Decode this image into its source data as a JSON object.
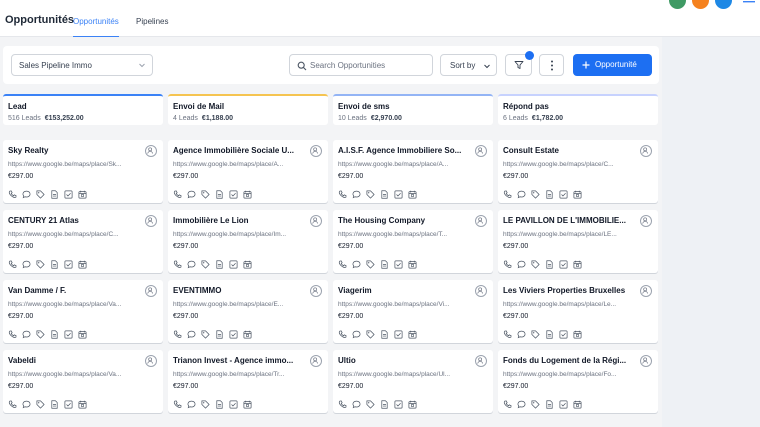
{
  "header": {
    "title": "Opportunités",
    "tabs": [
      {
        "label": "Opportunités",
        "active": true
      },
      {
        "label": "Pipelines",
        "active": false
      }
    ],
    "avatar_colors": [
      "#3f9a64",
      "#f5821f",
      "#1e88e5"
    ]
  },
  "toolbar": {
    "pipeline_select": "Sales Pipeline Immo",
    "search_placeholder": "Search Opportunities",
    "sort_label": "Sort by",
    "add_label": "Opportunité"
  },
  "colors": {
    "primary": "#1d6ff2",
    "lead_accent": "#3b82f6",
    "mail_accent": "#f5c451",
    "sms_accent": "#93b4f5",
    "repond_accent": "#c7d2fe"
  },
  "columns": [
    {
      "name": "Lead",
      "leads": "516 Leads",
      "amount": "€153,252.00",
      "accent": "#3b82f6",
      "cards": [
        {
          "name": "Sky Realty",
          "url": "https://www.google.be/maps/place/Sk...",
          "price": "€297.00"
        },
        {
          "name": "CENTURY 21 Atlas",
          "url": "https://www.google.be/maps/place/C...",
          "price": "€297.00"
        },
        {
          "name": "Van Damme / F.",
          "url": "https://www.google.be/maps/place/Va...",
          "price": "€297.00"
        },
        {
          "name": "Vabeldi",
          "url": "https://www.google.be/maps/place/Va...",
          "price": "€297.00"
        }
      ]
    },
    {
      "name": "Envoi de Mail",
      "leads": "4 Leads",
      "amount": "€1,188.00",
      "accent": "#f5c451",
      "cards": [
        {
          "name": "Agence Immobilière Sociale U...",
          "url": "https://www.google.be/maps/place/A...",
          "price": "€297.00"
        },
        {
          "name": "Immobilière Le Lion",
          "url": "https://www.google.be/maps/place/Im...",
          "price": "€297.00"
        },
        {
          "name": "EVENTIMMO",
          "url": "https://www.google.be/maps/place/E...",
          "price": "€297.00"
        },
        {
          "name": "Trianon Invest - Agence immo...",
          "url": "https://www.google.be/maps/place/Tr...",
          "price": "€297.00"
        }
      ]
    },
    {
      "name": "Envoi de sms",
      "leads": "10 Leads",
      "amount": "€2,970.00",
      "accent": "#93b4f5",
      "cards": [
        {
          "name": "A.I.S.F. Agence Immobiliere So...",
          "url": "https://www.google.be/maps/place/A...",
          "price": "€297.00"
        },
        {
          "name": "The Housing Company",
          "url": "https://www.google.be/maps/place/T...",
          "price": "€297.00"
        },
        {
          "name": "Viagerim",
          "url": "https://www.google.be/maps/place/Vi...",
          "price": "€297.00"
        },
        {
          "name": "Ultio",
          "url": "https://www.google.be/maps/place/Ul...",
          "price": "€297.00"
        }
      ]
    },
    {
      "name": "Répond pas",
      "leads": "6 Leads",
      "amount": "€1,782.00",
      "accent": "#c7d2fe",
      "cards": [
        {
          "name": "Consult Estate",
          "url": "https://www.google.be/maps/place/C...",
          "price": "€297.00"
        },
        {
          "name": "LE PAVILLON DE L'IMMOBILIE...",
          "url": "https://www.google.be/maps/place/LE...",
          "price": "€297.00"
        },
        {
          "name": "Les Viviers Properties Bruxelles",
          "url": "https://www.google.be/maps/place/Le...",
          "price": "€297.00"
        },
        {
          "name": "Fonds du Logement de la Régi...",
          "url": "https://www.google.be/maps/place/Fo...",
          "price": "€297.00"
        }
      ]
    }
  ],
  "card_icons": [
    "phone-icon",
    "chat-icon",
    "tag-icon",
    "document-icon",
    "checkbox-icon",
    "calendar-icon"
  ]
}
